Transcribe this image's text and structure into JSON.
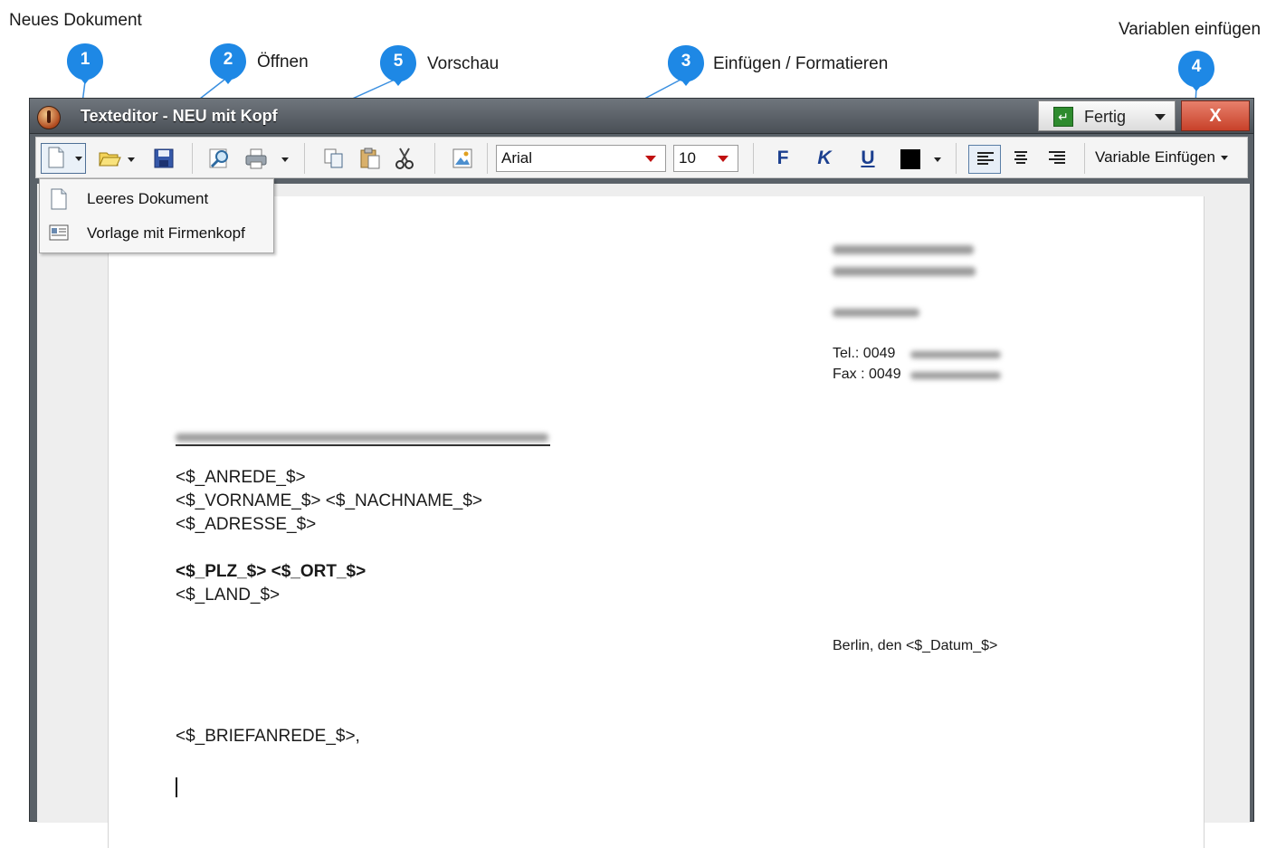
{
  "callouts": [
    {
      "number": "1",
      "label": "Neues Dokument"
    },
    {
      "number": "2",
      "label": "Öffnen"
    },
    {
      "number": "5",
      "label": "Vorschau"
    },
    {
      "number": "3",
      "label": "Einfügen / Formatieren"
    },
    {
      "number": "4",
      "label": "Variablen einfügen"
    }
  ],
  "window": {
    "title": "Texteditor - NEU mit Kopf",
    "fertig_label": "Fertig",
    "close_label": "X"
  },
  "toolbar": {
    "font_name": "Arial",
    "font_size": "10",
    "bold_label": "F",
    "italic_label": "K",
    "underline_label": "U",
    "text_color": "#000000",
    "variable_button_label": "Variable Einfügen"
  },
  "new_menu": {
    "items": [
      {
        "label": "Leeres Dokument",
        "icon": "blank-document-icon"
      },
      {
        "label": "Vorlage mit Firmenkopf",
        "icon": "template-icon"
      }
    ]
  },
  "document": {
    "tel": "Tel.: 0049",
    "fax": "Fax : 0049",
    "anrede": "<$_ANREDE_$>",
    "vorname_nachname": "<$_VORNAME_$>  <$_NACHNAME_$>",
    "adresse": "<$_ADRESSE_$>",
    "plz_ort": "<$_PLZ_$>  <$_ORT_$>",
    "land": "<$_LAND_$>",
    "datum_line": "Berlin, den <$_Datum_$>",
    "briefanrede": "<$_BRIEFANREDE_$>,"
  },
  "colors": {
    "callout_badge": "#1e88e5",
    "titlebar": "#555b61",
    "close_button": "#c8412a",
    "fertig_icon": "#2e8b2e"
  }
}
